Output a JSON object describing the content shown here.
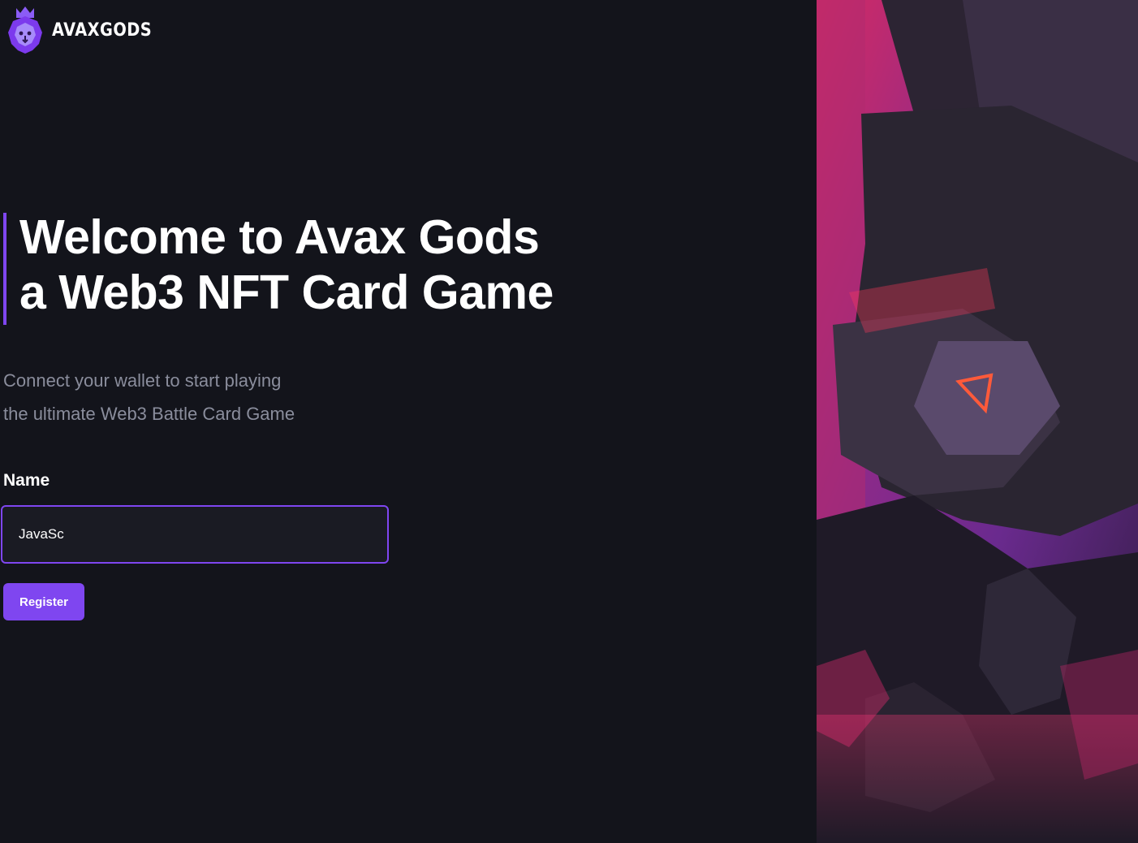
{
  "brand": {
    "name": "AVAXGODS",
    "icon": "lion-crown-icon",
    "accent_color": "#7f46f0"
  },
  "hero": {
    "headline_line1": "Welcome to Avax Gods",
    "headline_line2": "a Web3 NFT Card Game",
    "subtitle_line1": "Connect your wallet to start playing",
    "subtitle_line2": "the ultimate Web3 Battle Card Game"
  },
  "form": {
    "name_label": "Name",
    "name_value": "JavaSc",
    "register_label": "Register"
  },
  "colors": {
    "background": "#13141b",
    "input_background": "#1a1b23",
    "subtitle_text": "#8a8d9c",
    "art_magenta": "#e0306e",
    "art_purple": "#5b2a86"
  }
}
